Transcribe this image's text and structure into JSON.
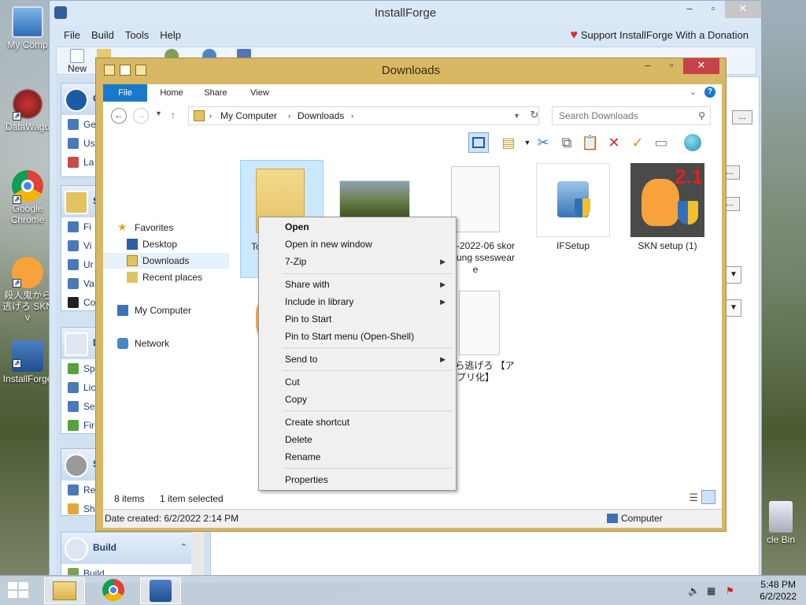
{
  "desktop": {
    "icons": [
      {
        "label": "My Comp"
      },
      {
        "label": "DataWago"
      },
      {
        "label": "Google Chrome"
      },
      {
        "label": "殺人鬼から逃げろ SKN v"
      },
      {
        "label": "InstallForge"
      }
    ],
    "recycle_bin_label": "cle Bin"
  },
  "installforge": {
    "title": "InstallForge",
    "menu": [
      "File",
      "Build",
      "Tools",
      "Help"
    ],
    "donate": "Support InstallForge With a Donation",
    "toolbar": {
      "new_label": "New",
      "open_label": "O"
    },
    "side": {
      "panel1_title": "G",
      "panel1_items": [
        "Ge",
        "Us",
        "La"
      ],
      "panel2_title": "S",
      "panel2_items": [
        "Fi",
        "Vi",
        "Ur",
        "Va",
        "Co"
      ],
      "panel3_title": "D",
      "panel3_items": [
        "Sp",
        "Lic",
        "Se",
        "Fir"
      ],
      "panel4_title": "S",
      "panel4_items": [
        "Re",
        "Sh"
      ],
      "build_title": "Build",
      "build_item": "Build"
    },
    "browse_label": "..."
  },
  "explorer": {
    "title": "Downloads",
    "tabs": [
      "File",
      "Home",
      "Share",
      "View"
    ],
    "address": {
      "crumbs": [
        "My Computer",
        "Downloads"
      ]
    },
    "search": {
      "placeholder": "Search Downloads"
    },
    "nav": {
      "favorites": "Favorites",
      "desktop": "Desktop",
      "downloads": "Downloads",
      "recent": "Recent places",
      "computer": "My Computer",
      "network": "Network"
    },
    "files": [
      {
        "label": "To oft LY_ _LA"
      },
      {
        "label": ""
      },
      {
        "label": "BOU-2022-06 skorpts-sung ssesweare"
      },
      {
        "label": "IFSetup"
      },
      {
        "label": "SKN setup (1)"
      },
      {
        "label": "S"
      },
      {
        "label": "鬼から逃げろ 【アプリ化】"
      }
    ],
    "status": {
      "count": "8 items",
      "selected": "1 item selected"
    },
    "details": {
      "date_created": "Date created: 6/2/2022 2:14 PM",
      "location": "Computer"
    }
  },
  "context_menu": {
    "items": [
      {
        "label": "Open",
        "bold": true
      },
      {
        "label": "Open in new window"
      },
      {
        "label": "7-Zip",
        "submenu": true
      },
      {
        "label": "Share with",
        "submenu": true
      },
      {
        "label": "Include in library",
        "submenu": true
      },
      {
        "label": "Pin to Start"
      },
      {
        "label": "Pin to Start menu (Open-Shell)"
      },
      {
        "label": "Send to",
        "submenu": true
      },
      {
        "label": "Cut"
      },
      {
        "label": "Copy"
      },
      {
        "label": "Create shortcut"
      },
      {
        "label": "Delete"
      },
      {
        "label": "Rename"
      },
      {
        "label": "Properties"
      }
    ]
  },
  "taskbar": {
    "time": "5:48 PM",
    "date": "6/2/2022"
  },
  "colors": {
    "explorer_frame": "#d8b765",
    "ribbon_file": "#1979ca",
    "installforge_frame": "#d8e6f5",
    "close_button": "#c7414b"
  }
}
